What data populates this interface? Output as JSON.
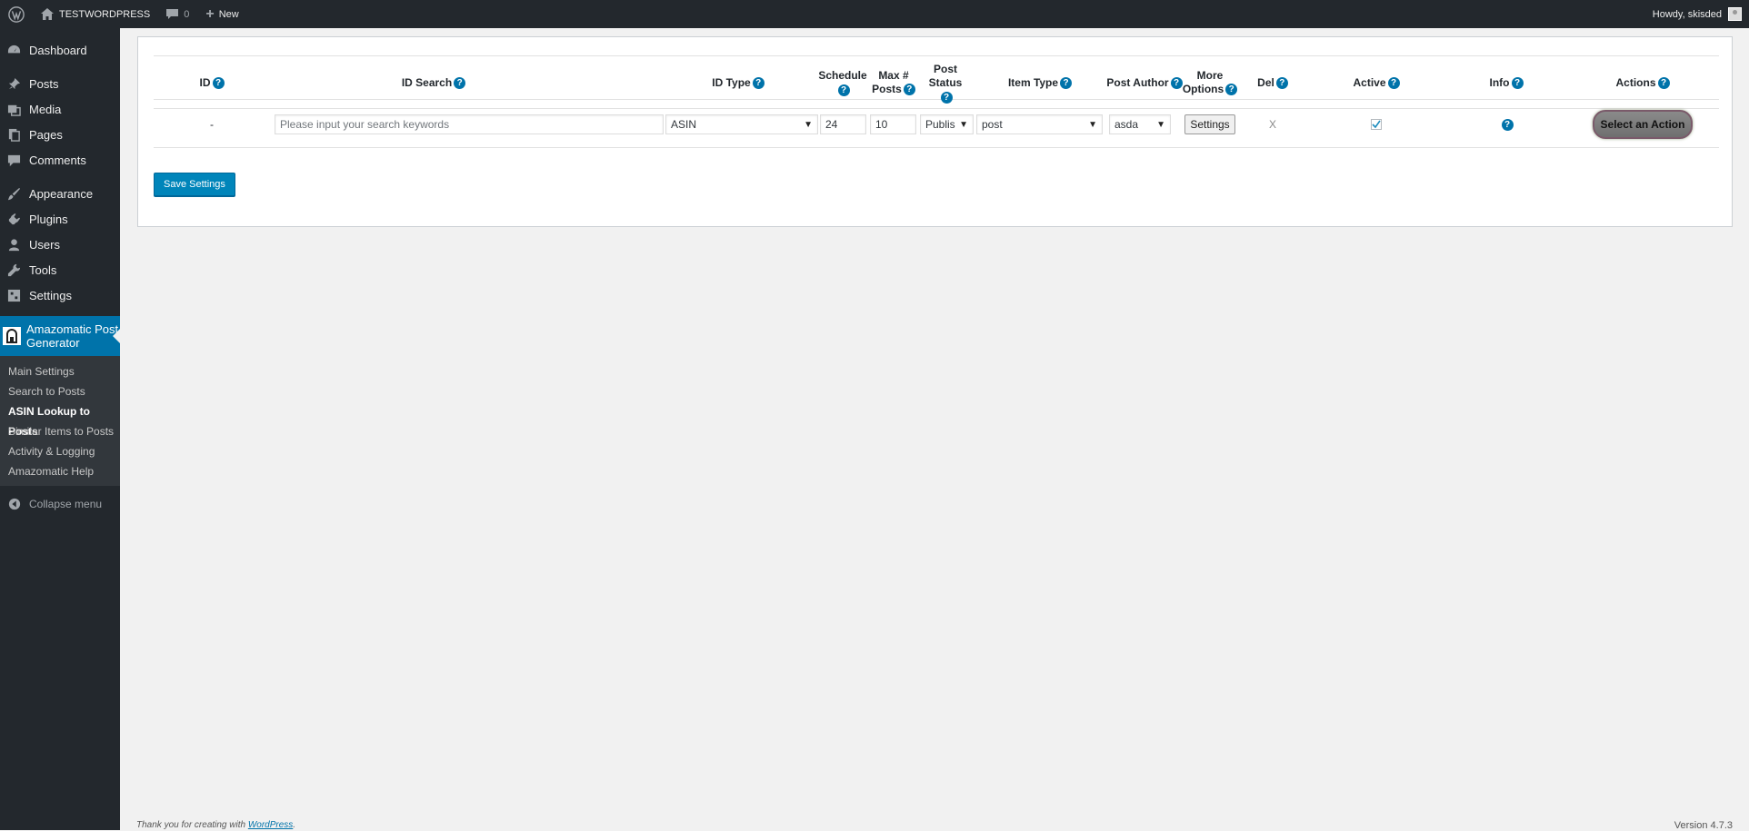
{
  "adminbar": {
    "site_name": "TESTWORDPRESS",
    "comments_count": "0",
    "new_label": "New",
    "howdy": "Howdy, skisded"
  },
  "sidebar": {
    "items": [
      {
        "label": "Dashboard",
        "icon": "dashboard-icon"
      },
      {
        "label": "Posts",
        "icon": "pin-icon"
      },
      {
        "label": "Media",
        "icon": "media-icon"
      },
      {
        "label": "Pages",
        "icon": "pages-icon"
      },
      {
        "label": "Comments",
        "icon": "comment-icon"
      },
      {
        "label": "Appearance",
        "icon": "brush-icon"
      },
      {
        "label": "Plugins",
        "icon": "plug-icon"
      },
      {
        "label": "Users",
        "icon": "user-icon"
      },
      {
        "label": "Tools",
        "icon": "wrench-icon"
      },
      {
        "label": "Settings",
        "icon": "settings-icon"
      }
    ],
    "plugin_line1": "Amazomatic Post",
    "plugin_line2": "Generator",
    "submenu": [
      "Main Settings",
      "Search to Posts",
      "ASIN Lookup to Posts",
      "Similar Items to Posts",
      "Activity & Logging",
      "Amazomatic Help"
    ],
    "collapse": "Collapse menu"
  },
  "table": {
    "headers": {
      "id": "ID",
      "id_search": "ID Search",
      "id_type": "ID Type",
      "schedule": "Schedule",
      "max_posts_1": "Max #",
      "max_posts_2": "Posts",
      "post_status": "Post Status",
      "item_type": "Item Type",
      "post_author": "Post Author",
      "more_options_1": "More",
      "more_options_2": "Options",
      "del": "Del",
      "active": "Active",
      "info": "Info",
      "actions": "Actions"
    },
    "row": {
      "id": "-",
      "search_placeholder": "Please input your search keywords",
      "id_type": "ASIN",
      "schedule": "24",
      "max_posts": "10",
      "post_status": "Publis",
      "item_type": "post",
      "post_author": "asda",
      "settings_btn": "Settings",
      "del": "X",
      "action_btn": "Select an Action"
    }
  },
  "save_button": "Save Settings",
  "footer": {
    "thanks": "Thank you for creating with ",
    "wp_link": "WordPress",
    "period": ".",
    "version": "Version 4.7.3"
  }
}
